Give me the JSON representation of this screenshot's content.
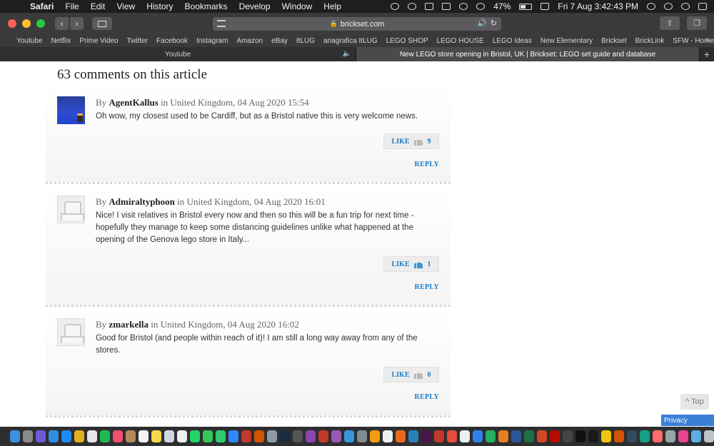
{
  "menubar": {
    "app_name": "Safari",
    "menus": [
      "File",
      "Edit",
      "View",
      "History",
      "Bookmarks",
      "Develop",
      "Window",
      "Help"
    ],
    "battery": "47%",
    "clock": "Fri 7 Aug  3:42:43 PM"
  },
  "toolbar": {
    "url": "brickset.com"
  },
  "bookmarks": [
    "Youtube",
    "Netflix",
    "Prime Video",
    "Twitter",
    "Facebook",
    "Instagram",
    "Amazon",
    "eBay",
    "ItLUG",
    "anagrafica ItLUG",
    "LEGO SHOP",
    "LEGO HOUSE",
    "LEGO Ideas",
    "New Elementary",
    "Brickset",
    "BrickLink",
    "SFW - Home"
  ],
  "tabs": [
    {
      "title": "Youtube"
    },
    {
      "title": "New LEGO store opening in Bristol, UK | Brickset: LEGO set guide and database"
    }
  ],
  "page": {
    "heading": "63 comments on this article",
    "by_label": "By",
    "like_label": "LIKE",
    "reply_label": "REPLY",
    "comments": [
      {
        "author": "AgentKallus",
        "location": "in United Kingdom, 04 Aug 2020 15:54",
        "text": "Oh wow, my closest used to be Cardiff, but as a Bristol native this is very welcome news.",
        "likes": "9"
      },
      {
        "author": "Admiraltyphoon",
        "location": "in United Kingdom, 04 Aug 2020 16:01",
        "text": "Nice! I visit relatives in Bristol every now and then so this will be a fun trip for next time - hopefully they manage to keep some distancing guidelines unlike what happened at the opening of the Genova lego store in Italy...",
        "likes": "1"
      },
      {
        "author": "zmarkella",
        "location": "in United Kingdom, 04 Aug 2020 16:02",
        "text": "Good for Bristol (and people within reach of it)! I am still a long way away from any of the stores.",
        "likes": "0"
      }
    ],
    "to_top": "^ Top",
    "privacy": "Privacy"
  },
  "colors": {
    "link_blue": "#1a7ec8",
    "menubar_bg": "#1e1e1e",
    "toolbar_bg": "#3a3a3c"
  }
}
